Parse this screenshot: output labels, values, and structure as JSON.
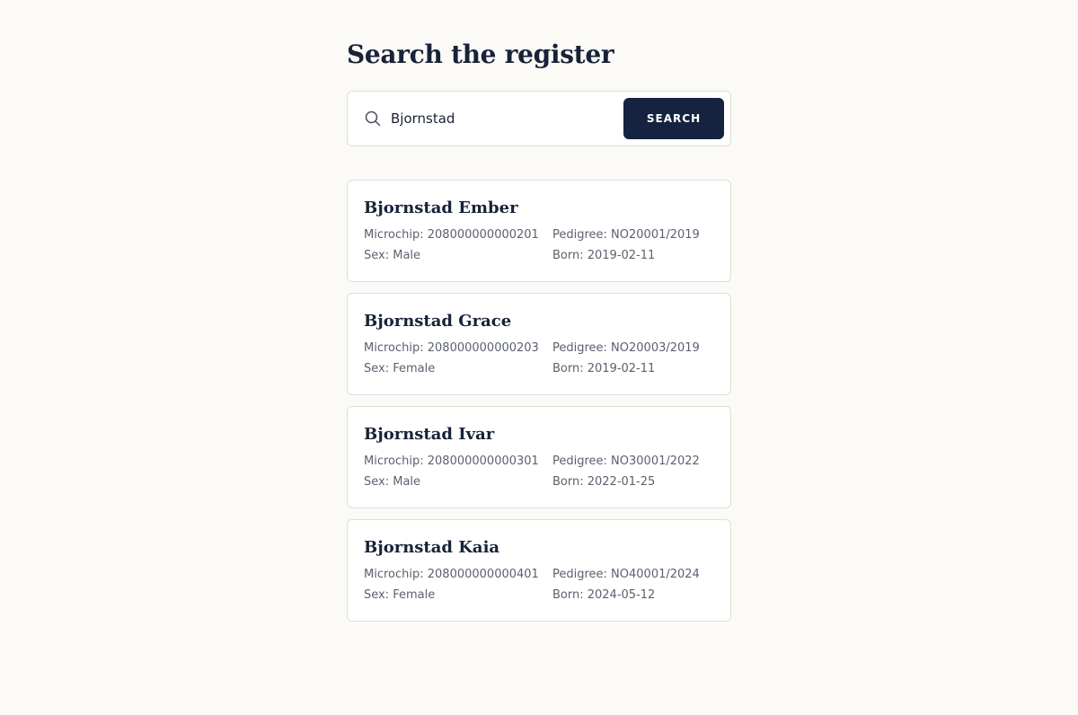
{
  "page": {
    "title": "Search the register"
  },
  "search": {
    "value": "Bjornstad",
    "button_label": "SEARCH",
    "icon": "search-icon"
  },
  "results": [
    {
      "name": "Bjornstad Ember",
      "microchip": "Microchip: 208000000000201",
      "sex": "Sex: Male",
      "pedigree": "Pedigree: NO20001/2019",
      "born": "Born: 2019-02-11"
    },
    {
      "name": "Bjornstad Grace",
      "microchip": "Microchip: 208000000000203",
      "sex": "Sex: Female",
      "pedigree": "Pedigree: NO20003/2019",
      "born": "Born: 2019-02-11"
    },
    {
      "name": "Bjornstad Ivar",
      "microchip": "Microchip: 208000000000301",
      "sex": "Sex: Male",
      "pedigree": "Pedigree: NO30001/2022",
      "born": "Born: 2022-01-25"
    },
    {
      "name": "Bjornstad Kaia",
      "microchip": "Microchip: 208000000000401",
      "sex": "Sex: Female",
      "pedigree": "Pedigree: NO40001/2024",
      "born": "Born: 2024-05-12"
    }
  ],
  "colors": {
    "background": "#fbfaf7",
    "accent": "#162340",
    "card_border": "#e2ded6",
    "muted_text": "#5b6170"
  }
}
